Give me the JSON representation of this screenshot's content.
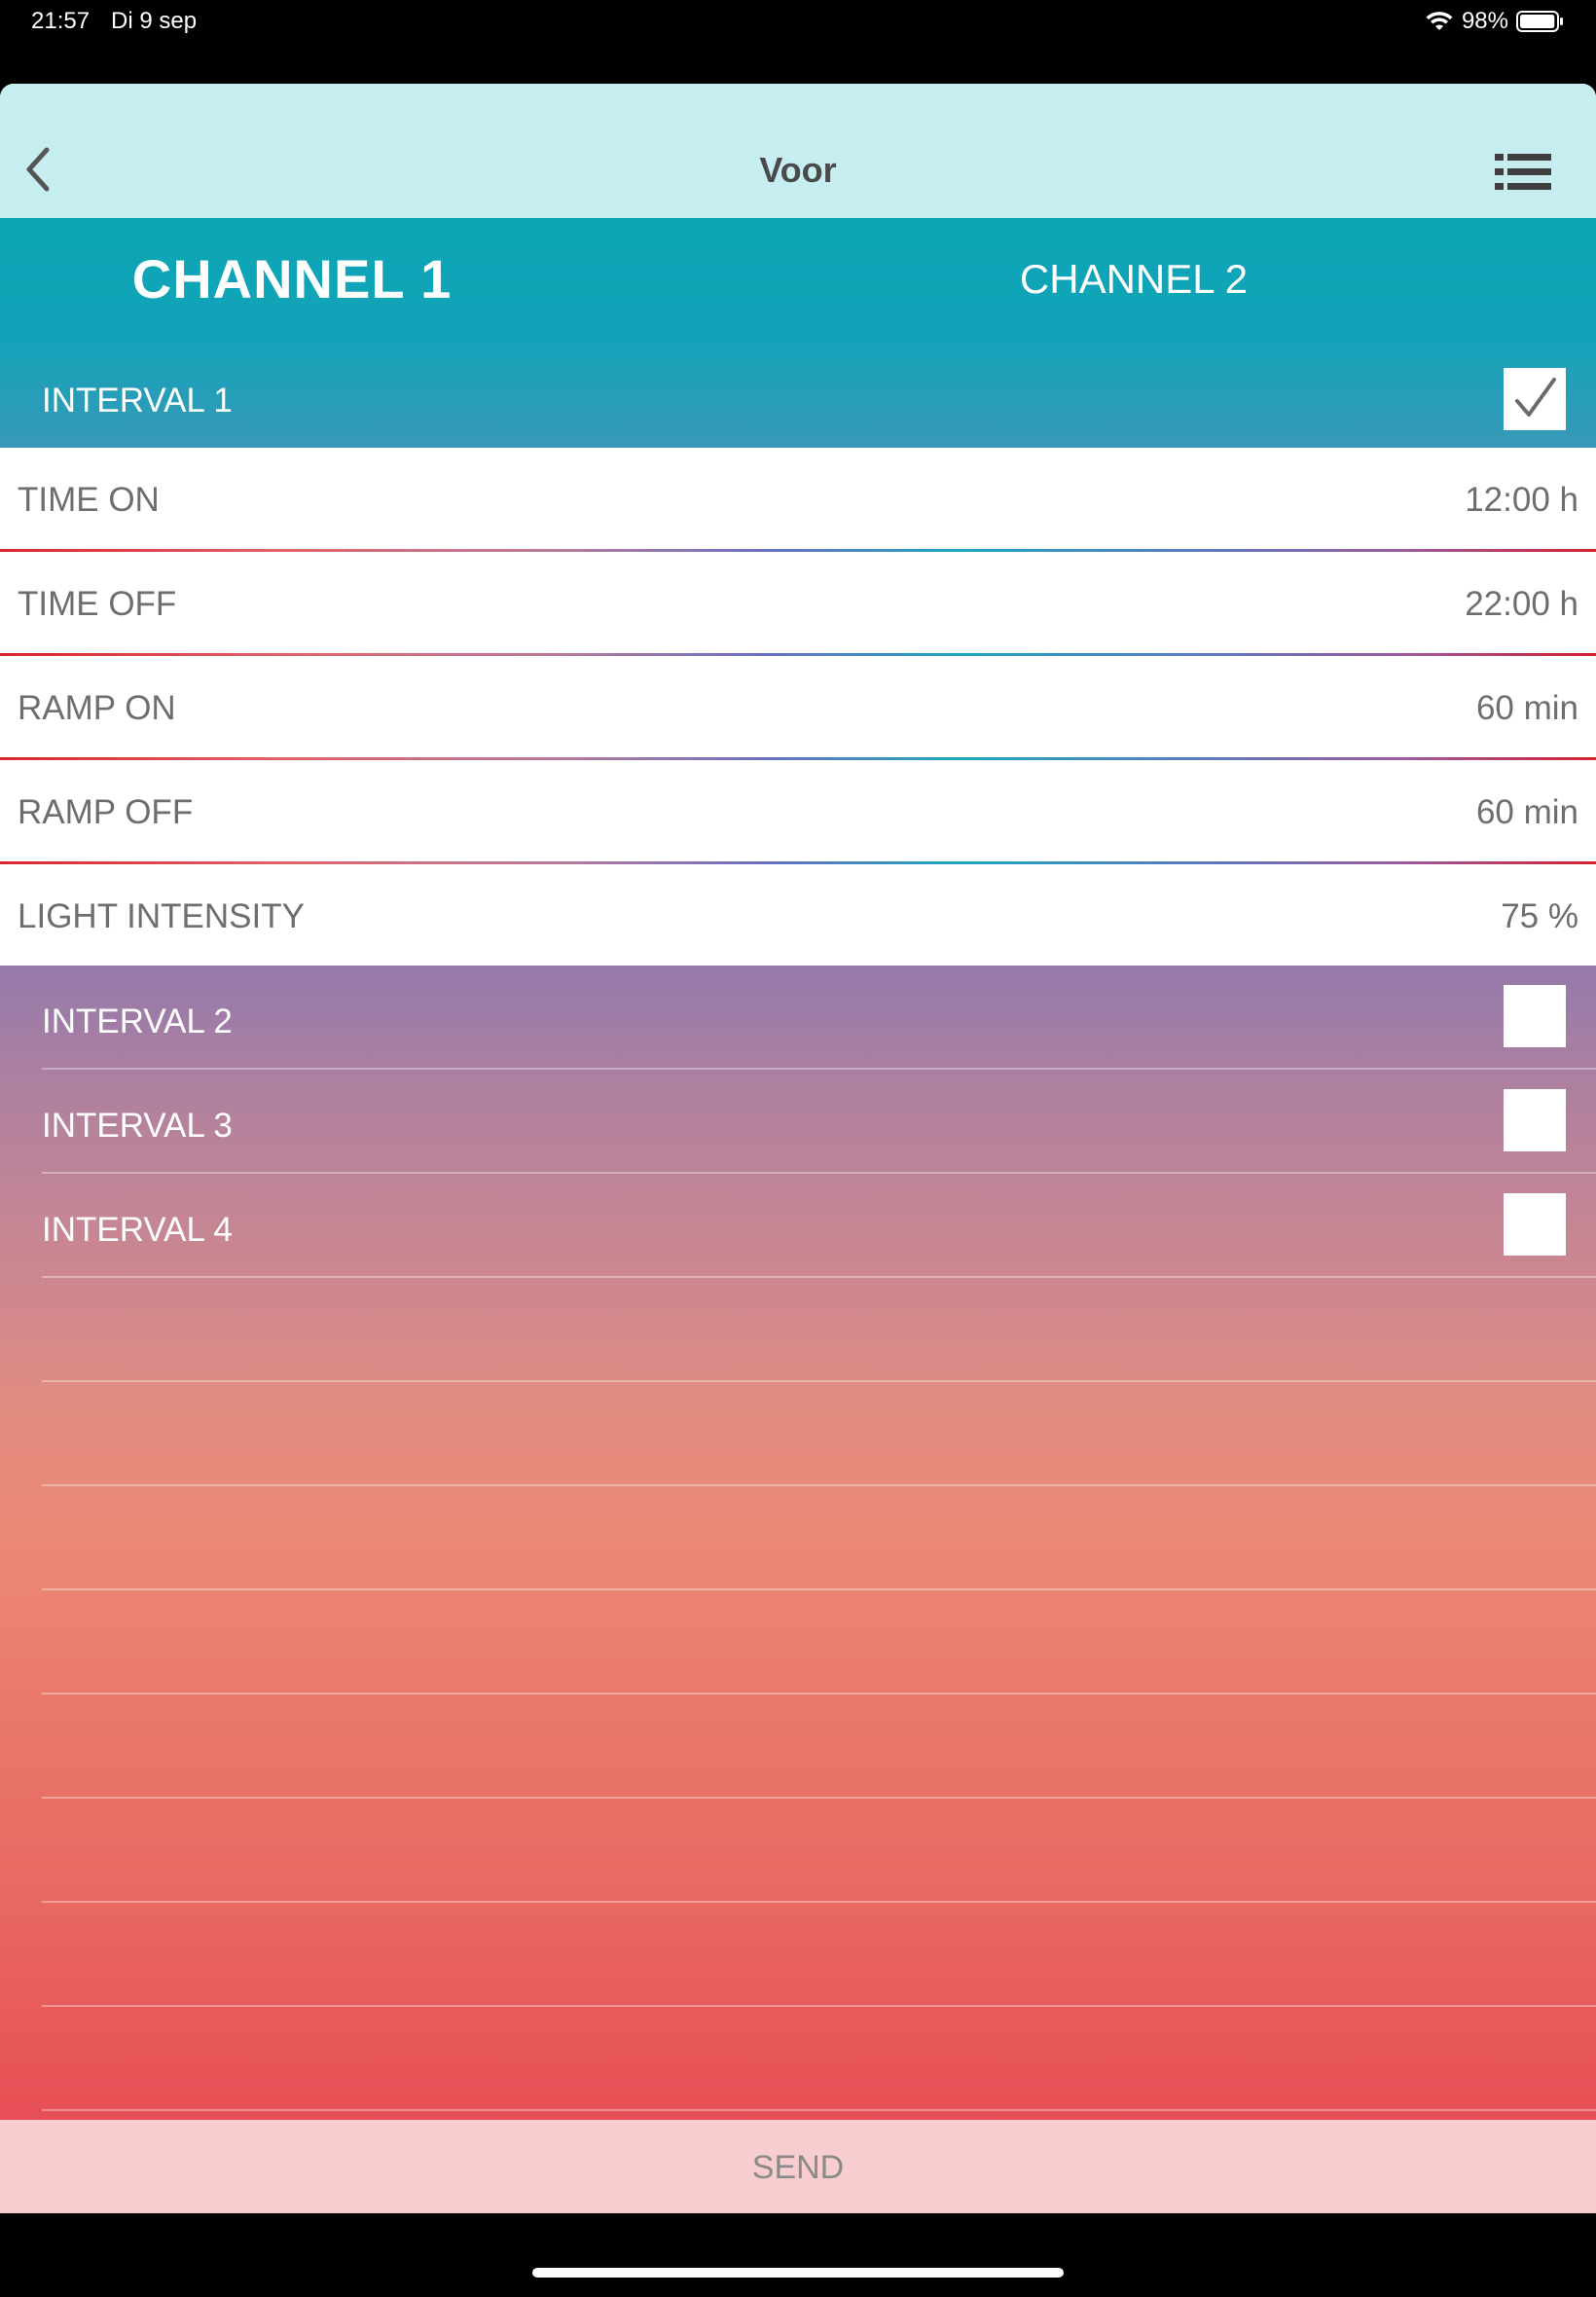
{
  "status_bar": {
    "time": "21:57",
    "date": "Di 9 sep",
    "battery_percent": "98%",
    "battery_level": 0.98
  },
  "navbar": {
    "title": "Voor",
    "back_icon": "chevron-left-icon",
    "menu_icon": "list-icon"
  },
  "tabs": [
    {
      "label": "CHANNEL 1",
      "selected": true
    },
    {
      "label": "CHANNEL 2",
      "selected": false
    }
  ],
  "intervals": [
    {
      "label": "INTERVAL 1",
      "checked": true
    },
    {
      "label": "INTERVAL 2",
      "checked": false
    },
    {
      "label": "INTERVAL 3",
      "checked": false
    },
    {
      "label": "INTERVAL 4",
      "checked": false
    }
  ],
  "settings": [
    {
      "label": "TIME ON",
      "value": "12:00 h"
    },
    {
      "label": "TIME OFF",
      "value": "22:00 h"
    },
    {
      "label": "RAMP ON",
      "value": "60 min"
    },
    {
      "label": "RAMP OFF",
      "value": "60 min"
    },
    {
      "label": "LIGHT INTENSITY",
      "value": "75 %"
    }
  ],
  "send_button": {
    "label": "SEND"
  },
  "colors": {
    "navbar_bg": "#c6edf0",
    "tab_bg": "#0aa6b6",
    "send_bg": "#f8cdd0",
    "gradient_top": "#957aac",
    "gradient_bottom": "#e74e55"
  }
}
